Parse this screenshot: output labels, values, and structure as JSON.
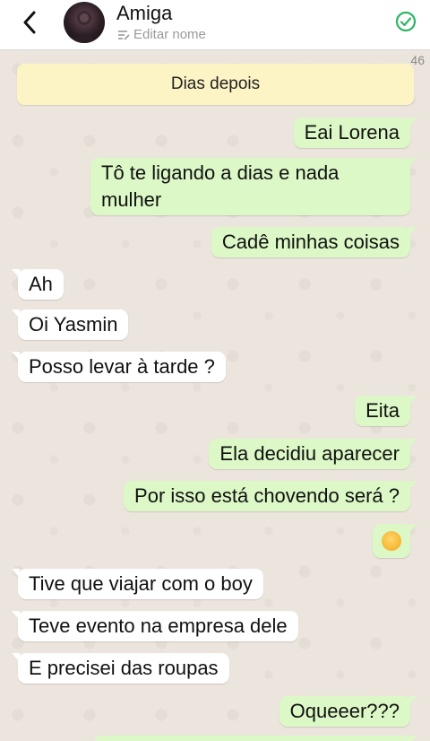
{
  "header": {
    "contact_name": "Amiga",
    "edit_label": "Editar nome"
  },
  "chat": {
    "unread_count": "46",
    "system_message": "Dias depois",
    "messages": [
      {
        "dir": "out",
        "text": "Eai Lorena"
      },
      {
        "dir": "out",
        "text": "Tô te ligando a dias e nada mulher"
      },
      {
        "dir": "out",
        "text": "Cadê minhas coisas"
      },
      {
        "dir": "in",
        "text": "Ah"
      },
      {
        "dir": "in",
        "text": "Oi Yasmin"
      },
      {
        "dir": "in",
        "text": "Posso levar à tarde ?"
      },
      {
        "dir": "out",
        "text": "Eita"
      },
      {
        "dir": "out",
        "text": "Ela decidiu aparecer"
      },
      {
        "dir": "out",
        "text": "Por isso está chovendo será ?"
      },
      {
        "dir": "out",
        "text": "",
        "emoji": "unamused-face-icon"
      },
      {
        "dir": "in",
        "text": "Tive que viajar com o boy"
      },
      {
        "dir": "in",
        "text": "Teve evento na empresa dele"
      },
      {
        "dir": "in",
        "text": "E precisei das roupas"
      },
      {
        "dir": "out",
        "text": "Oqueeer???"
      }
    ]
  },
  "colors": {
    "outgoing_bubble": "#dcf8c6",
    "incoming_bubble": "#ffffff",
    "system_bubble": "#fdf4c5",
    "background": "#ece5dd",
    "accent": "#2fb463"
  }
}
